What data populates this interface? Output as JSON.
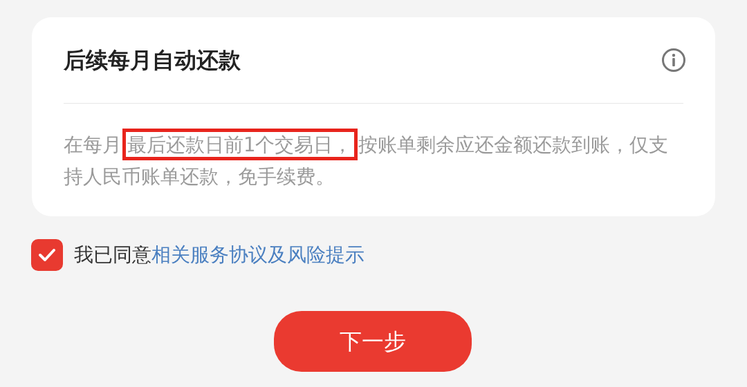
{
  "card": {
    "title": "后续每月自动还款",
    "description": [
      {
        "text": "在每月",
        "highlighted": false
      },
      {
        "text": "最后还款日前1个交易日，",
        "highlighted": true
      },
      {
        "text": "按账单剩余应还金额还款到账，仅支持人民币账单还款，免手续费。",
        "highlighted": false
      }
    ]
  },
  "agreement": {
    "checked": true,
    "text": "我已同意",
    "link": "相关服务协议及风险提示"
  },
  "next_button": "下一步"
}
